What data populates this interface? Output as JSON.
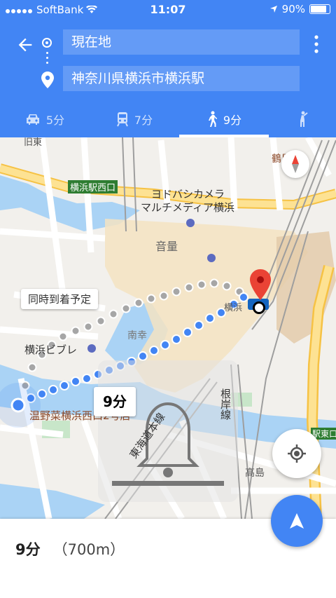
{
  "status_bar": {
    "carrier": "SoftBank",
    "time": "11:07",
    "battery": "90%"
  },
  "header": {
    "origin": "現在地",
    "destination": "神奈川県横浜市横浜駅"
  },
  "tabs": [
    {
      "icon": "car-icon",
      "label": "5分"
    },
    {
      "icon": "train-icon",
      "label": "7分"
    },
    {
      "icon": "walk-icon",
      "label": "9分",
      "active": true
    },
    {
      "icon": "ride-icon",
      "label": ""
    }
  ],
  "map": {
    "labels": {
      "yokohama_west": "横浜駅西口",
      "yodobashi_1": "ヨドバシカメラ",
      "yodobashi_2": "マルチメディア横浜",
      "volume": "音量",
      "nanko": "南幸",
      "yokohama": "横浜",
      "vivre": "横浜ビブレ",
      "onyasai": "温野菜横浜西口2号店",
      "tokaido": "東海道本線",
      "negishi": "根岸線",
      "takashima": "高島",
      "tsuruya": "鶴屋",
      "east_exit": "駅東口",
      "kyuto": "旧東"
    },
    "callouts": {
      "simultaneous": "同時到着予定",
      "time": "9分"
    }
  },
  "bottom": {
    "duration": "9分",
    "distance": "（700m）"
  },
  "colors": {
    "accent": "#4285f4",
    "route": "#4285f4",
    "pin": "#ea4335"
  }
}
